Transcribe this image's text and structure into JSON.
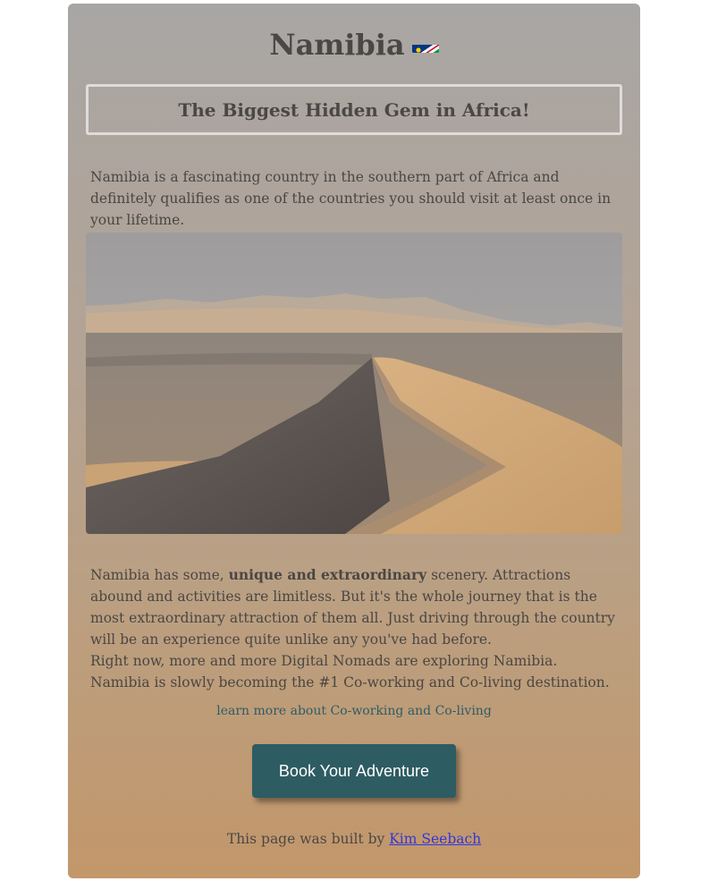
{
  "page": {
    "title": "Namibia",
    "flag_icon": "namibia-flag-icon",
    "subtitle": "The Biggest Hidden Gem in Africa!",
    "intro": "Namibia is a fascinating country in the southern part of Africa and definitely qualifies as one of the countries you should visit at least once in your lifetime."
  },
  "photo": {
    "subject": "desert-dune-photo"
  },
  "body": {
    "p1_before": "Namibia has some, ",
    "p1_bold": "unique and extraordinary",
    "p1_after": " scenery. Attractions abound and activities are limitless. But it's the whole journey that is the most extraordinary attraction of them all. Just driving through the country will be an experience quite unlike any you've had before.",
    "p2": "Right now, more and more Digital Nomads are exploring Namibia. Namibia is slowly becoming the #1 Co-working and Co-living destination."
  },
  "links": {
    "learn_more": "learn more about Co-working and Co-living"
  },
  "cta": {
    "label": "Book Your Adventure"
  },
  "footer": {
    "text": "This page was built by ",
    "author_link": "Kim Seebach"
  },
  "colors": {
    "accent": "#2e5c63",
    "link": "#3535d6",
    "card_top": "#a8a6a5",
    "card_bottom": "#c2976a"
  }
}
